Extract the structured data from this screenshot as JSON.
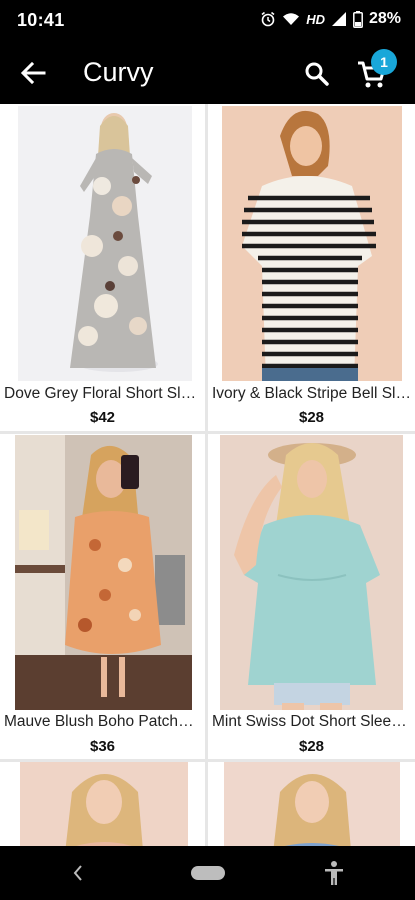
{
  "status_bar": {
    "time": "10:41",
    "network": "HD",
    "battery": "28%"
  },
  "app_bar": {
    "title": "Curvy",
    "cart_count": "1"
  },
  "products": [
    {
      "name": "Dove Grey Floral Short Sleeve Maxi Dress",
      "price": "$42"
    },
    {
      "name": "Ivory & Black Stripe Bell Sleeve Top",
      "price": "$28"
    },
    {
      "name": "Mauve Blush Boho Patchwork Dress",
      "price": "$36"
    },
    {
      "name": "Mint Swiss Dot Short Sleeve Top",
      "price": "$28"
    },
    {
      "name": "",
      "price": ""
    },
    {
      "name": "",
      "price": ""
    }
  ],
  "colors": {
    "bar_bg": "#000000",
    "badge": "#19a7d9",
    "grid_bg": "#e6e6e6"
  }
}
